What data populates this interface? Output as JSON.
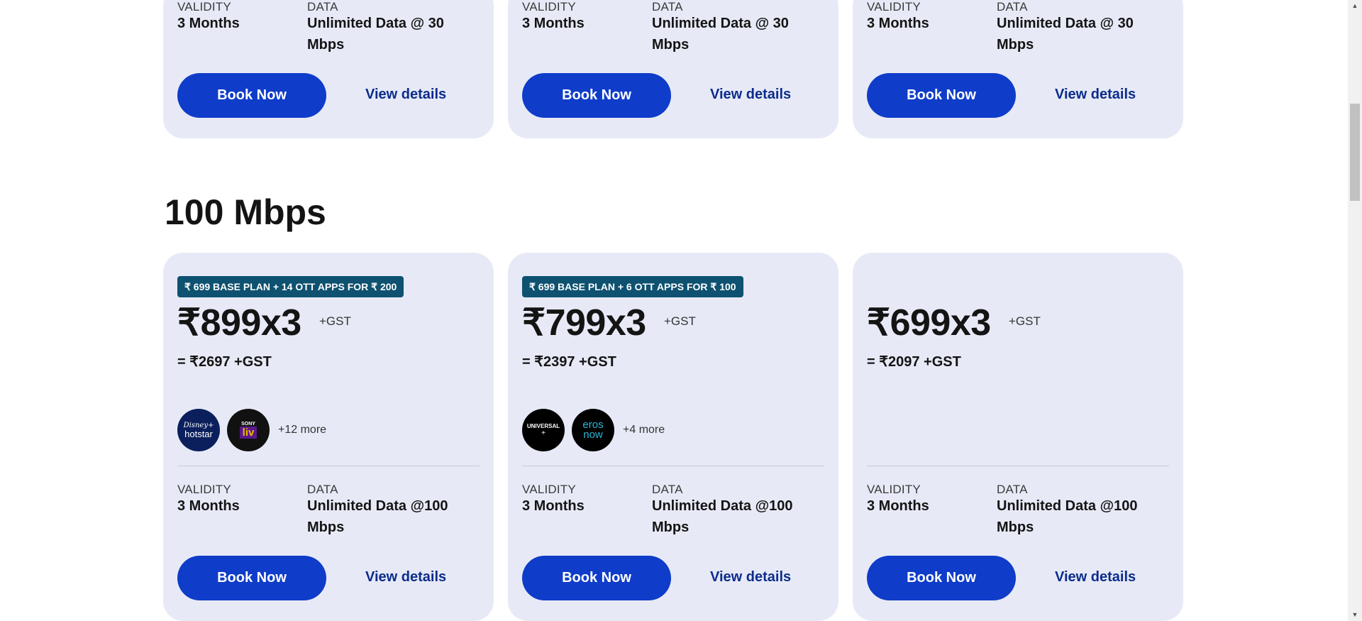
{
  "top_cards": [
    {
      "validity_label": "VALIDITY",
      "validity_value": "3 Months",
      "data_label": "DATA",
      "data_line1": "Unlimited Data @ 30",
      "data_line2": "Mbps",
      "book": "Book Now",
      "view": "View details"
    },
    {
      "validity_label": "VALIDITY",
      "validity_value": "3 Months",
      "data_label": "DATA",
      "data_line1": "Unlimited Data @ 30",
      "data_line2": "Mbps",
      "book": "Book Now",
      "view": "View details"
    },
    {
      "validity_label": "VALIDITY",
      "validity_value": "3 Months",
      "data_label": "DATA",
      "data_line1": "Unlimited Data @ 30",
      "data_line2": "Mbps",
      "book": "Book Now",
      "view": "View details"
    }
  ],
  "section": {
    "title": "100 Mbps"
  },
  "cards": [
    {
      "badge": "₹ 699 BASE PLAN + 14 OTT APPS FOR ₹ 200",
      "price": "₹899x3",
      "gst": "+GST",
      "total": "= ₹2697 +GST",
      "ott": [
        {
          "name": "Disney+ hotstar",
          "line1": "Disney+",
          "line2": "hotstar"
        },
        {
          "name": "Sony LIV",
          "line1": "SONY",
          "line2": "liv"
        }
      ],
      "more": "+12 more",
      "validity_label": "VALIDITY",
      "validity_value": "3 Months",
      "data_label": "DATA",
      "data_line1": "Unlimited Data @100",
      "data_line2": "Mbps",
      "book": "Book Now",
      "view": "View details"
    },
    {
      "badge": "₹ 699 BASE PLAN + 6 OTT APPS FOR ₹ 100",
      "price": "₹799x3",
      "gst": "+GST",
      "total": "= ₹2397 +GST",
      "ott": [
        {
          "name": "Universal+",
          "line1": "UNIVERSAL",
          "line2": "+"
        },
        {
          "name": "Eros Now",
          "line1": "eros",
          "line2": "now"
        }
      ],
      "more": "+4 more",
      "validity_label": "VALIDITY",
      "validity_value": "3 Months",
      "data_label": "DATA",
      "data_line1": "Unlimited Data @100",
      "data_line2": "Mbps",
      "book": "Book Now",
      "view": "View details"
    },
    {
      "badge": "",
      "price": "₹699x3",
      "gst": "+GST",
      "total": "= ₹2097 +GST",
      "ott": [],
      "more": "",
      "validity_label": "VALIDITY",
      "validity_value": "3 Months",
      "data_label": "DATA",
      "data_line1": "Unlimited Data @100",
      "data_line2": "Mbps",
      "book": "Book Now",
      "view": "View details"
    }
  ],
  "colors": {
    "card_bg": "#e7eaf6",
    "button": "#0f3cc9",
    "link": "#0c2c8c",
    "badge": "#0e5170"
  }
}
